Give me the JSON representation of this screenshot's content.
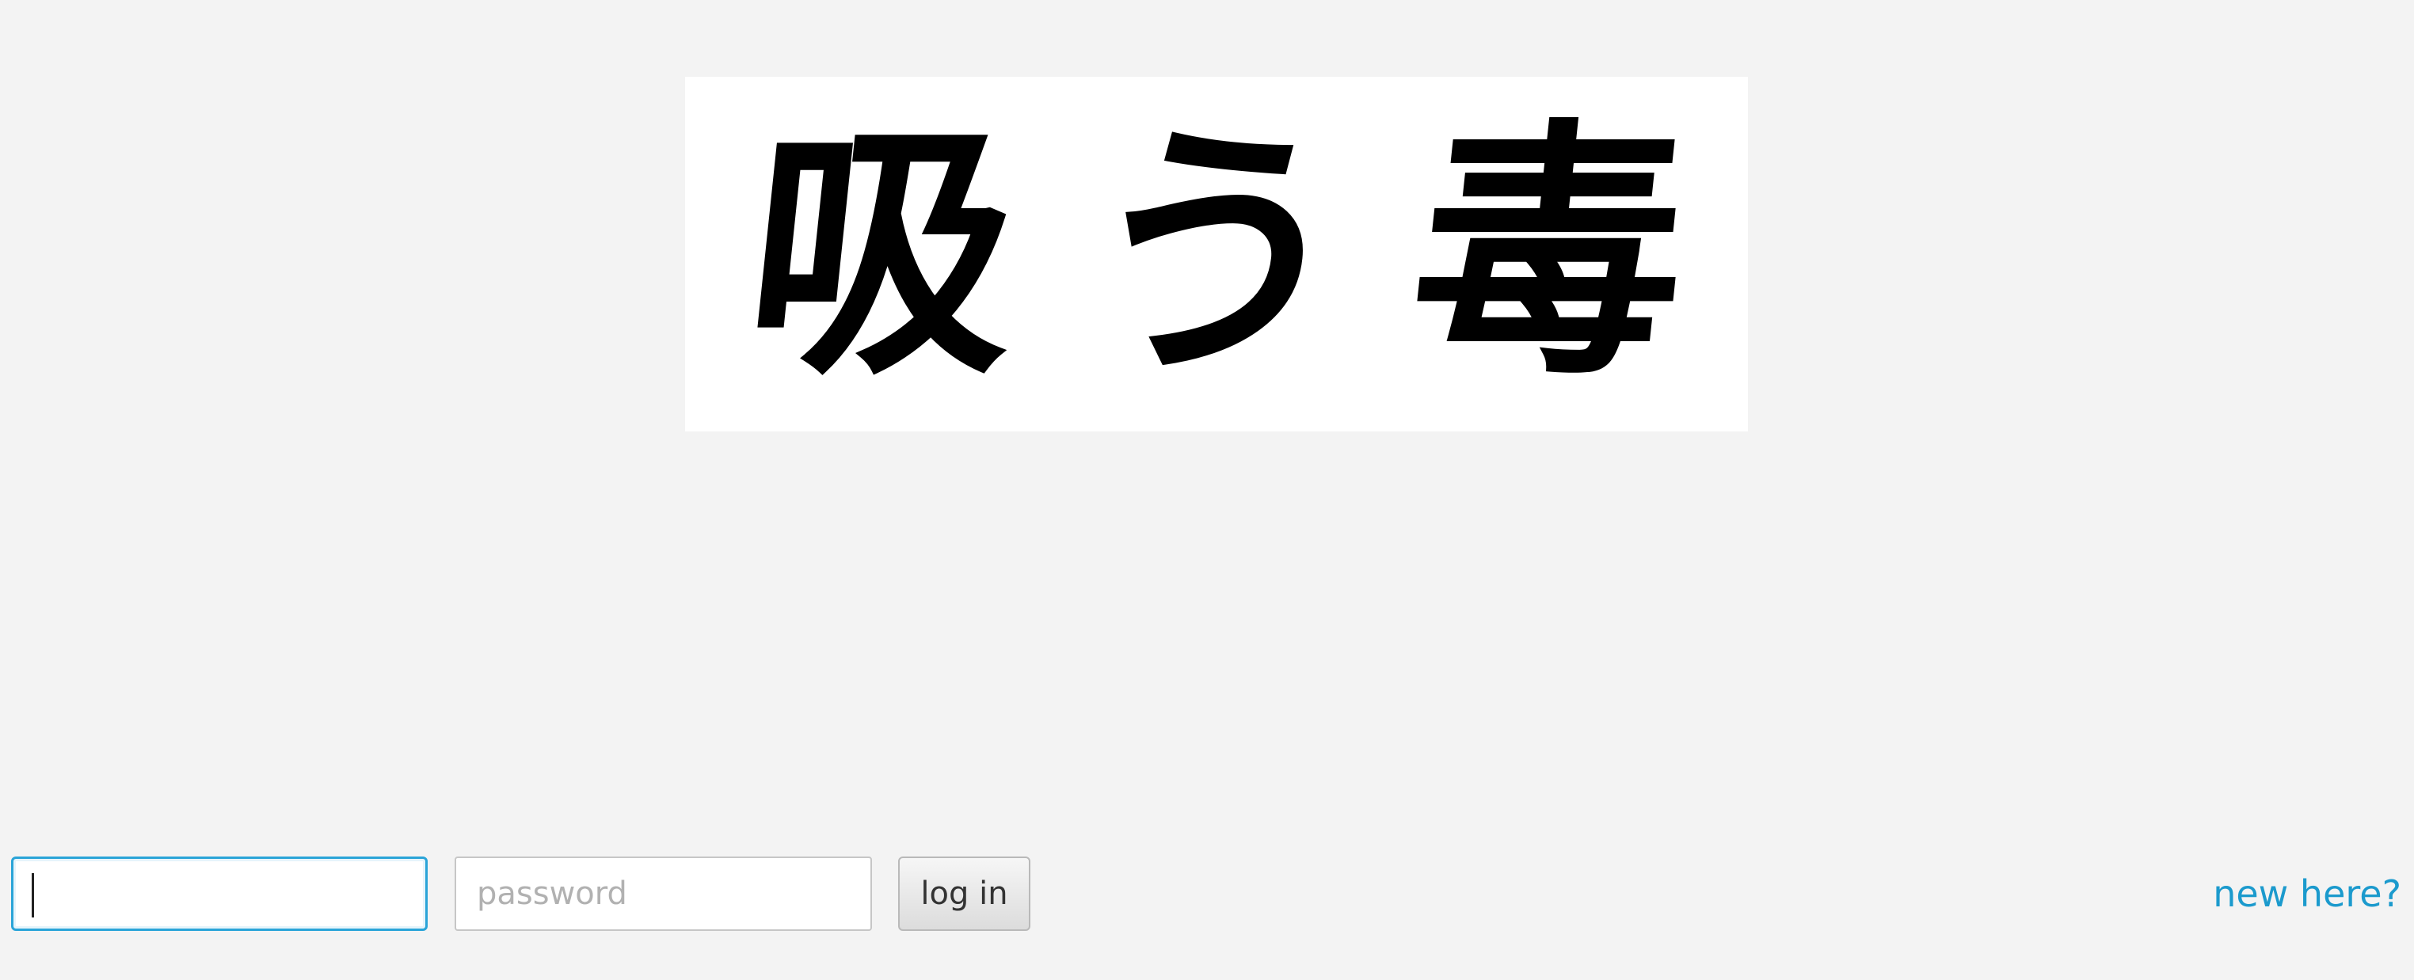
{
  "captcha": {
    "characters": [
      "吸",
      "う",
      "毒"
    ]
  },
  "login": {
    "username_value": "",
    "username_placeholder": "",
    "password_placeholder": "password",
    "login_label": "log in",
    "new_here_label": "new here?"
  },
  "colors": {
    "background": "#f3f3f3",
    "focus_border": "#2aa4d8",
    "link": "#1b9acd"
  }
}
